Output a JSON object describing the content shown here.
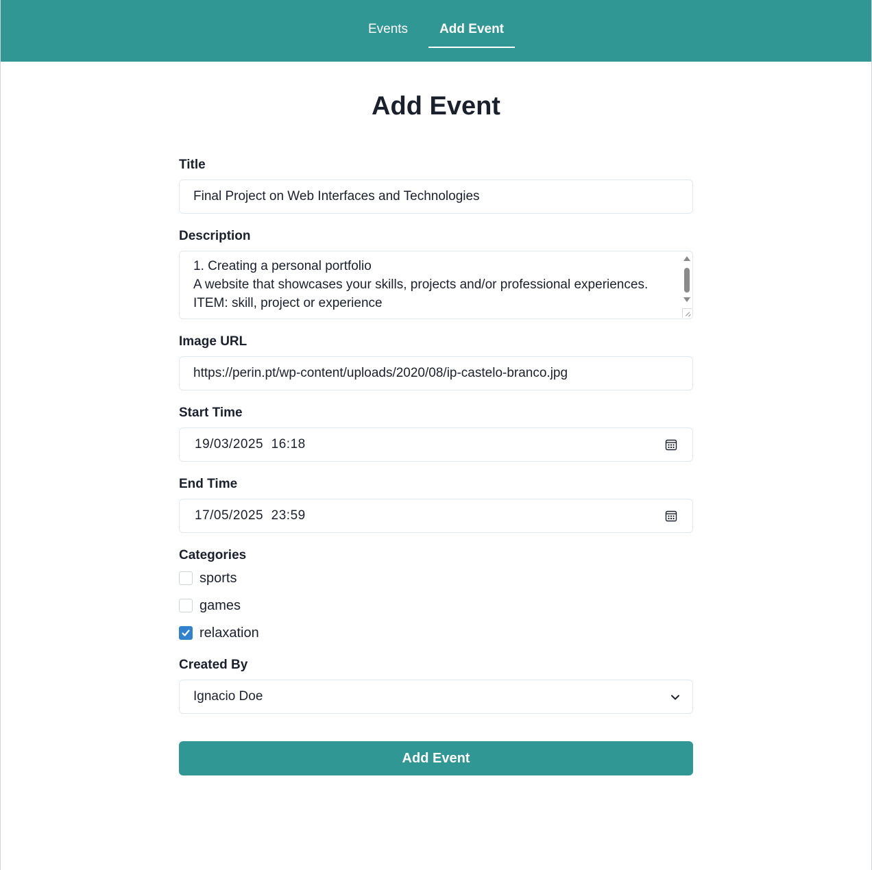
{
  "nav": {
    "events_label": "Events",
    "add_event_label": "Add Event"
  },
  "page": {
    "title": "Add Event"
  },
  "form": {
    "title": {
      "label": "Title",
      "value": "Final Project on Web Interfaces and Technologies"
    },
    "description": {
      "label": "Description",
      "value": "1. Creating a personal portfolio\nA website that showcases your skills, projects and/or professional experiences.\nITEM: skill, project or experience"
    },
    "image_url": {
      "label": "Image URL",
      "value": "https://perin.pt/wp-content/uploads/2020/08/ip-castelo-branco.jpg"
    },
    "start_time": {
      "label": "Start Time",
      "value": "19/03/2025  16:18"
    },
    "end_time": {
      "label": "End Time",
      "value": "17/05/2025  23:59"
    },
    "categories": {
      "label": "Categories",
      "options": [
        {
          "label": "sports",
          "checked": false
        },
        {
          "label": "games",
          "checked": false
        },
        {
          "label": "relaxation",
          "checked": true
        }
      ]
    },
    "created_by": {
      "label": "Created By",
      "value": "Ignacio Doe"
    },
    "submit_label": "Add Event"
  },
  "colors": {
    "accent": "#319795",
    "checkbox_checked": "#3182ce",
    "text": "#1a202c",
    "border": "#e2e8f0"
  }
}
